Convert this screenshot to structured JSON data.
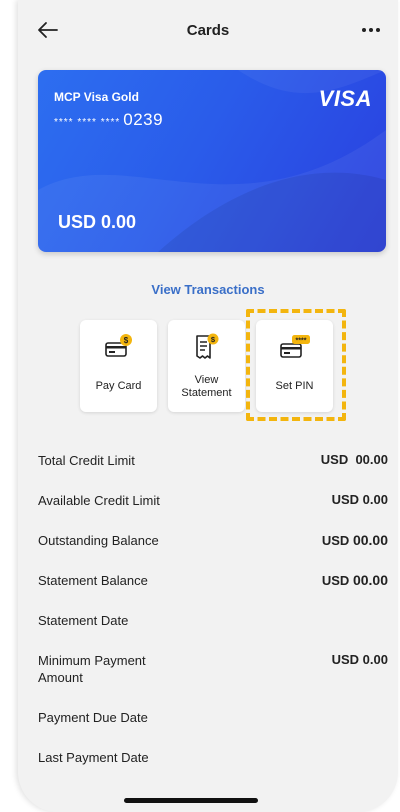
{
  "header": {
    "title": "Cards",
    "back_icon": "arrow-left-icon",
    "more_icon": "more-dots-icon"
  },
  "card": {
    "name": "MCP Visa Gold",
    "masked_number": "**** **** ****",
    "last_digits": "0239",
    "brand": "VISA",
    "balance": "USD 0.00",
    "color_start": "#2d6ef0",
    "color_end": "#2a3fdf"
  },
  "view_transactions": "View Transactions",
  "actions": [
    {
      "label": "Pay Card",
      "icon": "pay-card-icon"
    },
    {
      "label_line1": "View",
      "label_line2": "Statement",
      "icon": "statement-icon"
    },
    {
      "label": "Set PIN",
      "icon": "set-pin-icon"
    }
  ],
  "highlight_color": "#f3b50e",
  "details": [
    {
      "label": "Total Credit Limit",
      "currency": "USD",
      "amount": "00.00"
    },
    {
      "label": "Available Credit Limit",
      "value": "USD 0.00"
    },
    {
      "label": "Outstanding Balance",
      "currency": "USD",
      "amount": "00.00"
    },
    {
      "label": "Statement Balance",
      "currency": "USD",
      "amount": "00.00"
    },
    {
      "label": "Statement Date",
      "value": ""
    },
    {
      "label_line1": "Minimum Payment",
      "label_line2": "Amount",
      "value": "USD 0.00"
    },
    {
      "label": "Payment Due Date",
      "value": ""
    },
    {
      "label": "Last Payment Date",
      "value": ""
    }
  ]
}
